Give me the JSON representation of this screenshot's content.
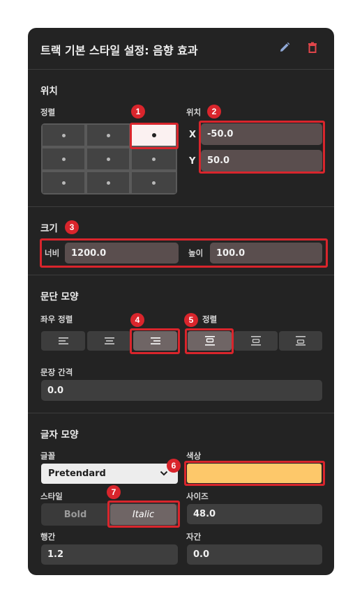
{
  "header": {
    "title": "트랙 기본 스타일 설정: 음향 효과",
    "edit_icon": "pencil-icon",
    "delete_icon": "trash-icon"
  },
  "position": {
    "section_title": "위치",
    "align_label": "정렬",
    "grid_selected": "top-right",
    "xy_label": "위치",
    "x_label": "X",
    "x_value": "-50.0",
    "y_label": "Y",
    "y_value": "50.0"
  },
  "size": {
    "section_title": "크기",
    "width_label": "너비",
    "width_value": "1200.0",
    "height_label": "높이",
    "height_value": "100.0"
  },
  "paragraph": {
    "section_title": "문단 모양",
    "h_align_label": "좌우 정렬",
    "h_align_selected": "right",
    "v_align_label": "정렬",
    "v_align_selected": "top",
    "line_spacing_label": "문장 간격",
    "line_spacing_value": "0.0"
  },
  "text": {
    "section_title": "글자 모양",
    "font_label": "글꼴",
    "font_value": "Pretendard",
    "color_label": "색상",
    "color_value": "#fdc86a",
    "style_label": "스타일",
    "bold_label": "Bold",
    "italic_label": "Italic",
    "style_selected": "italic",
    "size_label": "사이즈",
    "size_value": "48.0",
    "line_height_label": "행간",
    "line_height_value": "1.2",
    "letter_spacing_label": "자간",
    "letter_spacing_value": "0.0"
  },
  "badges": [
    "1",
    "2",
    "3",
    "4",
    "5",
    "6",
    "7"
  ],
  "colors": {
    "panel_bg": "#232323",
    "accent_red": "#d9252c",
    "edit_icon": "#8fa8d6",
    "delete_icon": "#e0454a",
    "selected_segment": "#6f6565"
  }
}
